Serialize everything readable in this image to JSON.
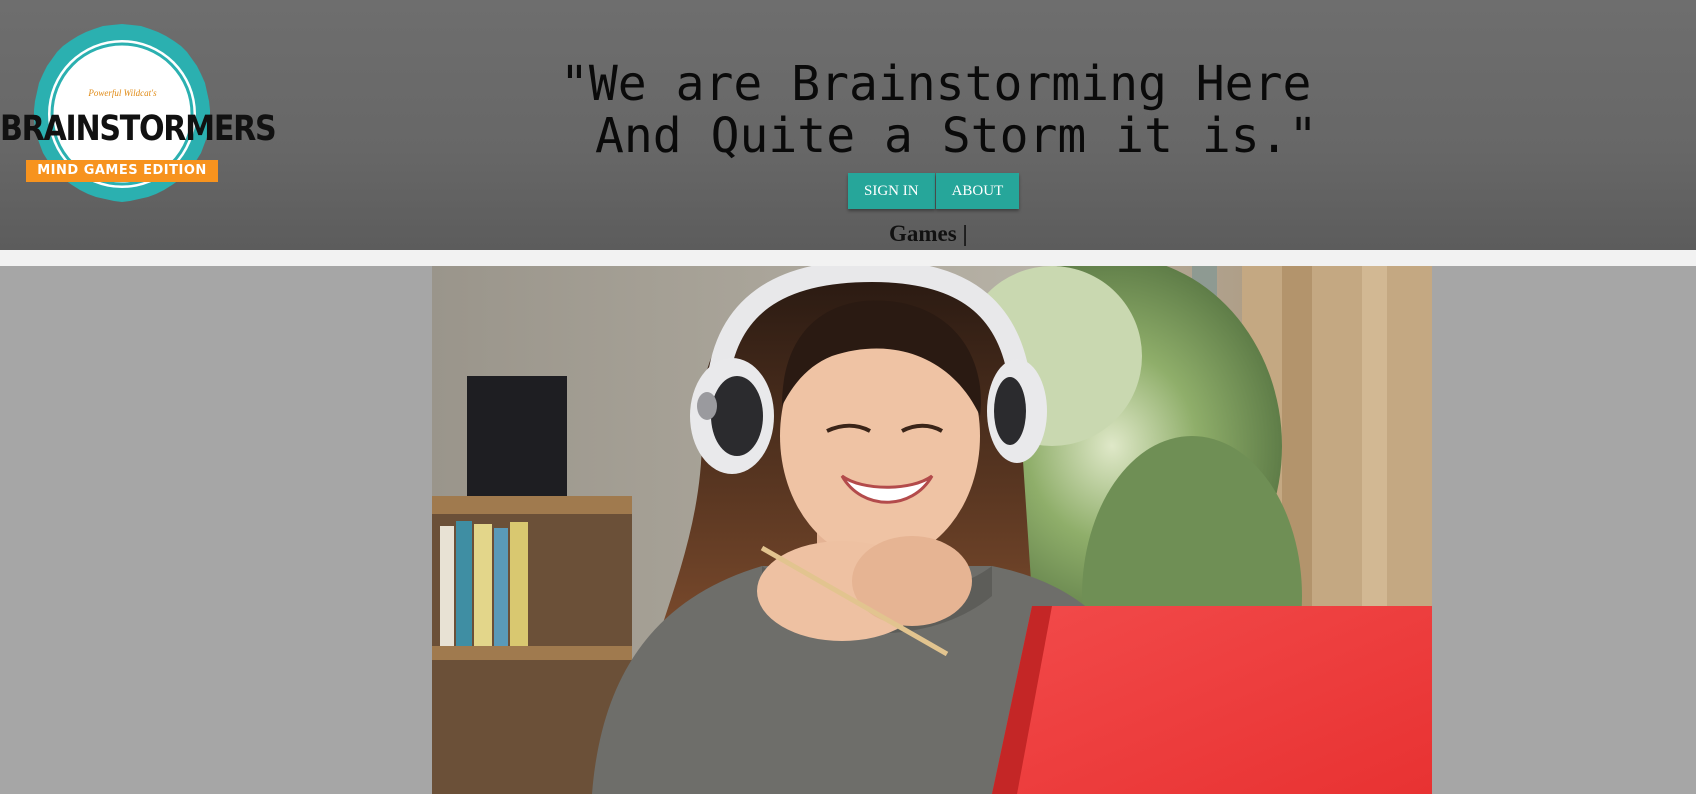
{
  "logo": {
    "tagline": "Powerful Wildcat's",
    "wordmark": "BRAINSTORMERS",
    "banner": "MIND GAMES EDITION"
  },
  "header": {
    "quote_line1": "\"We are Brainstorming Here",
    "quote_line2": "And Quite a Storm it is.\""
  },
  "nav": {
    "sign_in_label": "SIGN IN",
    "about_label": "ABOUT",
    "games_link": "Games |"
  },
  "hero": {
    "image": "woman-with-headphones-laptop-photo"
  },
  "colors": {
    "header_bg": "#676767",
    "button_bg": "#26a69a",
    "page_bg": "#a6a6a6",
    "logo_teal": "#2bb0b0",
    "logo_orange": "#f7931e"
  }
}
